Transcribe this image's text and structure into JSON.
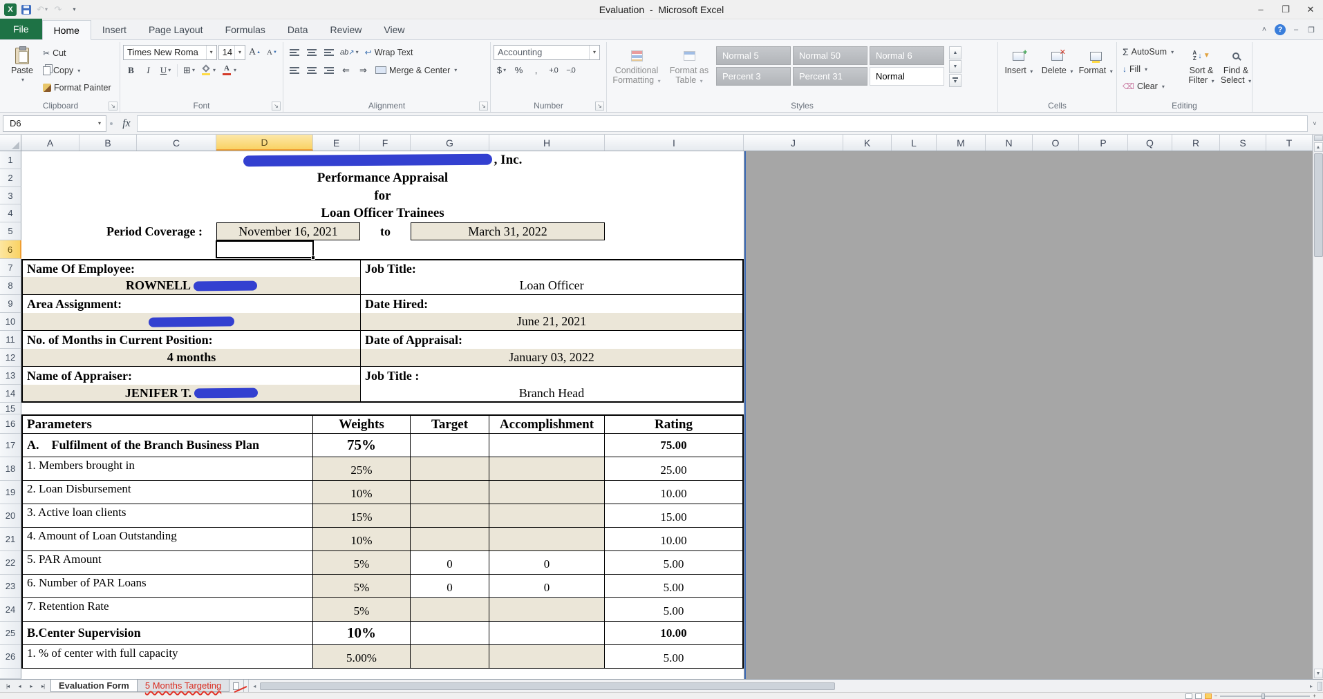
{
  "window": {
    "title": "Evaluation  -  Microsoft Excel",
    "minimize": "–",
    "restore": "❐",
    "close": "✕"
  },
  "icons": {
    "excel_logo": "X",
    "dropdown": "▾",
    "undo": "↶",
    "redo": "↷",
    "collapse_ribbon": "˄",
    "help": "?",
    "doc_minimize": "–",
    "doc_restore": "❐",
    "cut": "✂",
    "grow_font": "A",
    "shrink_font": "A",
    "up_tiny": "▲",
    "down_tiny": "▼",
    "borders": "⊞",
    "font_color_letter": "A",
    "orientation": "ab",
    "diag_arrow": "↗",
    "wrap_arrow": "↩",
    "indent_dec": "⇐",
    "indent_inc": "⇒",
    "inc_decimal": "+.0",
    "dec_decimal": "−.0",
    "launcher": "↘",
    "sigma": "Σ",
    "fill_down": "↓",
    "clear_eraser": "⌫",
    "sort_a": "A",
    "sort_z": "Z",
    "funnel": "▼",
    "insert_plus": "+",
    "delete_x": "✕",
    "scroll_up": "▲",
    "scroll_down": "▼",
    "scroll_left": "◂",
    "scroll_right": "▸",
    "tab_first": "|◂",
    "tab_prev": "◂",
    "tab_next": "▸",
    "tab_last": "▸|",
    "formula_expand": "˅",
    "zoom_out": "−",
    "zoom_in": "+"
  },
  "colors": {
    "file_tab_green": "#1e7245",
    "selection_amber": "#f9d264",
    "redaction_blue": "#3340d0",
    "print_area_border": "#3c6bb5",
    "cell_fill_cream": "#ebe6d8",
    "marked_tab_red": "#d92b1f",
    "outside_print_gray": "#a6a6a6"
  },
  "ribbon": {
    "tabs": [
      {
        "label": "File",
        "file": true
      },
      {
        "label": "Home",
        "active": true
      },
      {
        "label": "Insert"
      },
      {
        "label": "Page Layout"
      },
      {
        "label": "Formulas"
      },
      {
        "label": "Data"
      },
      {
        "label": "Review"
      },
      {
        "label": "View"
      }
    ],
    "clipboard": {
      "label": "Clipboard",
      "paste": "Paste",
      "cut": "Cut",
      "copy": "Copy",
      "format_painter": "Format Painter"
    },
    "font": {
      "label": "Font",
      "name": "Times New Roma",
      "size": "14",
      "bold": "B",
      "italic": "I",
      "underline": "U"
    },
    "alignment": {
      "label": "Alignment",
      "wrap_text": "Wrap Text",
      "merge_center": "Merge & Center"
    },
    "number": {
      "label": "Number",
      "format": "Accounting",
      "currency": "$",
      "percent": "%",
      "comma": ","
    },
    "styles": {
      "label": "Styles",
      "conditional_1": "Conditional",
      "conditional_2": "Formatting",
      "format_table_1": "Format as",
      "format_table_2": "Table",
      "gallery": [
        {
          "label": "Normal 5"
        },
        {
          "label": "Normal 50"
        },
        {
          "label": "Normal 6"
        },
        {
          "label": "Percent 3"
        },
        {
          "label": "Percent 31"
        },
        {
          "label": "Normal",
          "plain": true
        }
      ]
    },
    "cells": {
      "label": "Cells",
      "insert": "Insert",
      "delete": "Delete",
      "format": "Format"
    },
    "editing": {
      "label": "Editing",
      "autosum": "AutoSum",
      "fill": "Fill",
      "clear": "Clear",
      "sort_1": "Sort &",
      "sort_2": "Filter",
      "find_1": "Find &",
      "find_2": "Select"
    }
  },
  "formula_bar": {
    "name_box": "D6",
    "fx": "fx",
    "formula": ""
  },
  "grid": {
    "columns": [
      {
        "l": "A"
      },
      {
        "l": "B"
      },
      {
        "l": "C"
      },
      {
        "l": "D",
        "selected": true
      },
      {
        "l": "E"
      },
      {
        "l": "F"
      },
      {
        "l": "G"
      },
      {
        "l": "H"
      },
      {
        "l": "I"
      },
      {
        "l": "J"
      },
      {
        "l": "K"
      },
      {
        "l": "L"
      },
      {
        "l": "M"
      },
      {
        "l": "N"
      },
      {
        "l": "O"
      },
      {
        "l": "P"
      },
      {
        "l": "Q"
      },
      {
        "l": "R"
      },
      {
        "l": "S"
      },
      {
        "l": "T"
      }
    ],
    "rn1": "1",
    "rn2": "2",
    "rn3": "3",
    "rn4": "4",
    "rn5": "5",
    "rn6": "6",
    "rn15": "15",
    "rn16": "16"
  },
  "sheet": {
    "company_suffix": ", Inc.",
    "title2": "Performance Appraisal",
    "title3": "for",
    "title4": "Loan Officer Trainees",
    "period_label": "Period Coverage :",
    "period_from": "November 16, 2021",
    "period_to_word": "to",
    "period_to": "March 31, 2022",
    "info": [
      {
        "rn_label": "7",
        "rn_value": "8",
        "left_label": "Name Of Employee:",
        "right_label": "Job Title:",
        "left_value": "ROWNELL",
        "left_redacted": true,
        "right_value": "Loan Officer"
      },
      {
        "rn_label": "9",
        "rn_value": "10",
        "left_label": "Area Assignment:",
        "right_label": "Date Hired:",
        "left_value": "",
        "left_redacted": true,
        "wide_redaction": true,
        "right_value": "June 21, 2021",
        "right_cream": true
      },
      {
        "rn_label": "11",
        "rn_value": "12",
        "left_label": "No. of Months in Current Position:",
        "right_label": "Date of Appraisal:",
        "left_value": "4 months",
        "right_value": "January 03, 2022",
        "right_cream": true
      },
      {
        "rn_label": "13",
        "rn_value": "14",
        "left_label": "Name of Appraiser:",
        "right_label": "Job Title :",
        "left_value": "JENIFER T.",
        "left_redacted": true,
        "right_value": "Branch Head"
      }
    ],
    "table_headers": {
      "parameters": "Parameters",
      "weights": "Weights",
      "target": "Target",
      "accomplishment": "Accomplishment",
      "rating": "Rating"
    },
    "table_rows": [
      {
        "rn": "17",
        "name": "A.    Fulfilment of the Branch Business Plan",
        "weight": "75%",
        "target": "",
        "accomplishment": "",
        "rating": "75.00",
        "section": true
      },
      {
        "rn": "18",
        "name": "1. Members brought in",
        "weight": "25%",
        "target": "",
        "accomplishment": "",
        "rating": "25.00"
      },
      {
        "rn": "19",
        "name": "2. Loan Disbursement",
        "weight": "10%",
        "target": "",
        "accomplishment": "",
        "rating": "10.00"
      },
      {
        "rn": "20",
        "name": "3. Active loan clients",
        "weight": "15%",
        "target": "",
        "accomplishment": "",
        "rating": "15.00"
      },
      {
        "rn": "21",
        "name": "4. Amount of Loan Outstanding",
        "weight": "10%",
        "target": "",
        "accomplishment": "",
        "rating": "10.00"
      },
      {
        "rn": "22",
        "name": "5. PAR Amount",
        "weight": "5%",
        "target": "0",
        "accomplishment": "0",
        "rating": "5.00",
        "plainta": true
      },
      {
        "rn": "23",
        "name": "6. Number of PAR Loans",
        "weight": "5%",
        "target": "0",
        "accomplishment": "0",
        "rating": "5.00",
        "plainta": true
      },
      {
        "rn": "24",
        "name": "7. Retention Rate",
        "weight": "5%",
        "target": "",
        "accomplishment": "",
        "rating": "5.00"
      },
      {
        "rn": "25",
        "name": "B.Center Supervision",
        "weight": "10%",
        "target": "",
        "accomplishment": "",
        "rating": "10.00",
        "section": true
      },
      {
        "rn": "26",
        "name": "1. % of center with full capacity",
        "weight": "5.00%",
        "target": "",
        "accomplishment": "",
        "rating": "5.00"
      }
    ]
  },
  "sheet_tabs": [
    {
      "label": "Evaluation Form",
      "active": true
    },
    {
      "label": "5 Months Targeting",
      "marked": true
    }
  ]
}
